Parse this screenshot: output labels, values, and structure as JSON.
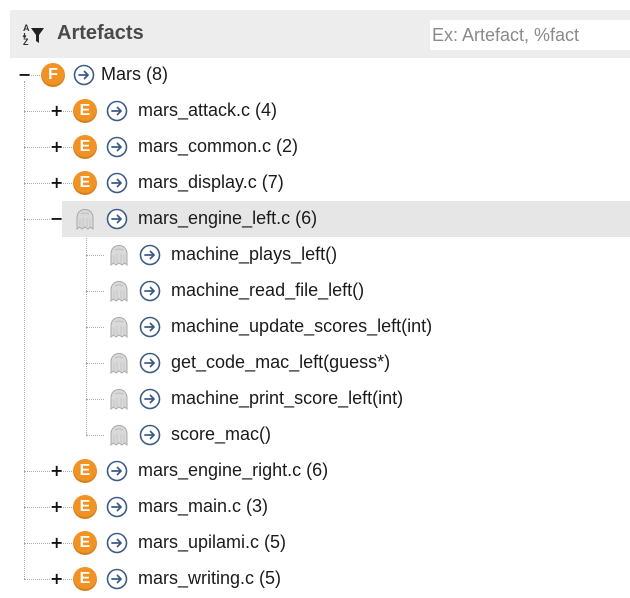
{
  "header": {
    "title": "Artefacts",
    "sort_icon": "sort-filter-icon",
    "search_placeholder": "Ex: Artefact, %fact",
    "search_value": ""
  },
  "colors": {
    "badge_orange": "#f19224",
    "nav_circle": "#3b5b86",
    "selected_row_bg": "#e6e6e6",
    "header_bg": "#ededed"
  },
  "tree": {
    "root": {
      "toggle": "−",
      "badge": "F",
      "nav_icon": "arrow-circle-right-icon",
      "label": "Mars (8)"
    },
    "files": [
      {
        "toggle": "+",
        "badge": "E",
        "label": "mars_attack.c (4)"
      },
      {
        "toggle": "+",
        "badge": "E",
        "label": "mars_common.c (2)"
      },
      {
        "toggle": "+",
        "badge": "E",
        "label": "mars_display.c (7)"
      },
      {
        "toggle": "−",
        "badge": "ghost",
        "label": "mars_engine_left.c (6)",
        "selected": true,
        "children": [
          {
            "label": "machine_plays_left()"
          },
          {
            "label": "machine_read_file_left()"
          },
          {
            "label": "machine_update_scores_left(int)"
          },
          {
            "label": "get_code_mac_left(guess*)"
          },
          {
            "label": "machine_print_score_left(int)"
          },
          {
            "label": "score_mac()"
          }
        ]
      },
      {
        "toggle": "+",
        "badge": "E",
        "label": "mars_engine_right.c (6)"
      },
      {
        "toggle": "+",
        "badge": "E",
        "label": "mars_main.c (3)"
      },
      {
        "toggle": "+",
        "badge": "E",
        "label": "mars_upilami.c (5)"
      },
      {
        "toggle": "+",
        "badge": "E",
        "label": "mars_writing.c (5)"
      }
    ]
  }
}
